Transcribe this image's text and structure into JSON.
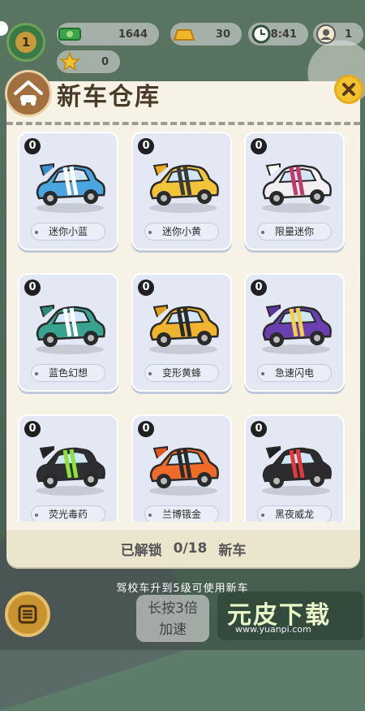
{
  "hud": {
    "level": "1",
    "cash": "1644",
    "gold": "30",
    "time": "8:41",
    "friends": "1",
    "stars": "0"
  },
  "modal": {
    "title": "新车仓库",
    "unlock_prefix": "已解锁",
    "unlock_count": "0/18",
    "unlock_suffix": "新车"
  },
  "cars": [
    {
      "name": "迷你小蓝",
      "count": "0",
      "body": "#4aa6e0",
      "roof": "#3c8fcf",
      "stripe": "#ffffff"
    },
    {
      "name": "迷你小黄",
      "count": "0",
      "body": "#f2c43a",
      "roof": "#e6ad1f",
      "stripe": "#3a3a3a"
    },
    {
      "name": "限量迷你",
      "count": "0",
      "body": "#f2f0f2",
      "roof": "#ffffff",
      "stripe": "#c43b6a"
    },
    {
      "name": "蓝色幻想",
      "count": "0",
      "body": "#3aa38f",
      "roof": "#2f8c7c",
      "stripe": "#ffffff"
    },
    {
      "name": "变形黄蜂",
      "count": "0",
      "body": "#f0b52c",
      "roof": "#e59f1f",
      "stripe": "#2a2a2a"
    },
    {
      "name": "急速闪电",
      "count": "0",
      "body": "#6a3fb0",
      "roof": "#5a33a0",
      "stripe": "#f2d04a"
    },
    {
      "name": "荧光毒药",
      "count": "0",
      "body": "#2e2e33",
      "roof": "#232327",
      "stripe": "#8be23a"
    },
    {
      "name": "兰博锇金",
      "count": "0",
      "body": "#f06a2a",
      "roof": "#e25620",
      "stripe": "#2a2a2a"
    },
    {
      "name": "黑夜威龙",
      "count": "0",
      "body": "#2c2c30",
      "roof": "#1f1f22",
      "stripe": "#e23a3a"
    }
  ],
  "bottom": {
    "tip": "驾校车升到5级可使用新车",
    "speed_line1": "长按3倍",
    "speed_line2": "加速",
    "watermark_title": "元皮下载",
    "watermark_url": "www.yuanpi.com"
  },
  "colors": {
    "modal_bg": "#f6f3e6",
    "card_bg": "#e3e8f4",
    "close_btn": "#f2c231",
    "title_color": "#4a3a28"
  }
}
